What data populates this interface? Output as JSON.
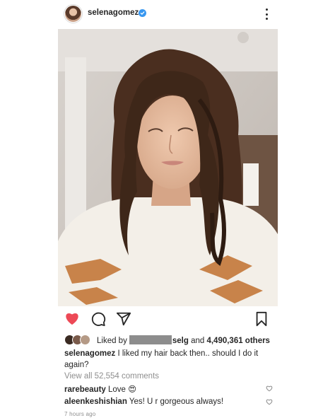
{
  "post": {
    "username": "selenagomez",
    "verified": true,
    "menu_icon": "more-vertical-icon"
  },
  "photo": {
    "alt_subject": "selfie photo"
  },
  "actions": {
    "like_icon": "heart-filled-icon",
    "comment_icon": "comment-icon",
    "share_icon": "send-icon",
    "save_icon": "bookmark-icon",
    "like_color": "#ed4956"
  },
  "likes": {
    "prefix": "Liked by",
    "partial_name": "selg",
    "connector": "and",
    "count": "4,490,361 others"
  },
  "caption": {
    "username": "selenagomez",
    "text": "I liked my hair back then.. should I do it again?"
  },
  "view_all": "View all 52,554 comments",
  "comments": [
    {
      "username": "rarebeauty",
      "text": "Love",
      "emoji": "😍"
    },
    {
      "username": "aleenkeshishian",
      "text": "Yes! U r gorgeous always!"
    }
  ],
  "timestamp": "7 hours ago"
}
